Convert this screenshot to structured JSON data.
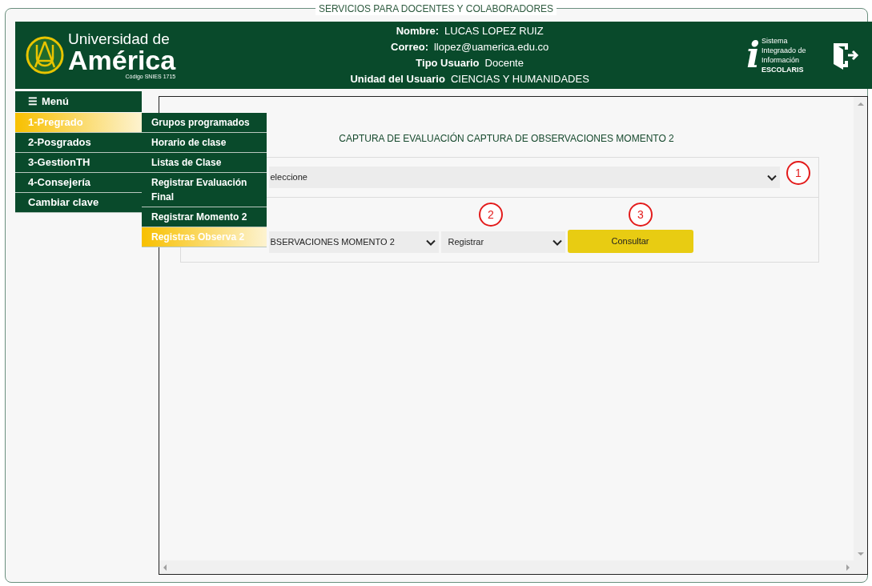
{
  "legend": "SERVICIOS PARA DOCENTES Y COLABORADORES",
  "logo": {
    "line1": "Universidad de",
    "line2": "América",
    "code": "Código SNIES 1715"
  },
  "user_info": [
    {
      "label": "Nombre:",
      "value": "LUCAS LOPEZ RUIZ"
    },
    {
      "label": "Correo:",
      "value": "llopez@uamerica.edu.co"
    },
    {
      "label": "Tipo Usuario",
      "value": "Docente"
    },
    {
      "label": "Unidad del Usuario",
      "value": "CIENCIAS Y HUMANIDADES"
    }
  ],
  "system_logo": {
    "letter": "i",
    "lines": [
      "Sistema",
      "Integraado de",
      "Información"
    ],
    "name": "ESCOLARIS"
  },
  "menu": {
    "icon": "☰",
    "title": "Menú",
    "items": [
      {
        "label": "1-Pregrado",
        "selected": true
      },
      {
        "label": "2-Posgrados",
        "selected": false
      },
      {
        "label": "3-GestionTH",
        "selected": false
      },
      {
        "label": "4-Consejería",
        "selected": false
      },
      {
        "label": "Cambiar clave",
        "selected": false
      }
    ]
  },
  "submenu": [
    {
      "label": "Grupos programados",
      "selected": false
    },
    {
      "label": "Horario de clase",
      "selected": false
    },
    {
      "label": "Listas de Clase",
      "selected": false
    },
    {
      "label": "Registrar Evaluación Final",
      "selected": false
    },
    {
      "label": "Registrar Momento 2",
      "selected": false
    },
    {
      "label": "Registras Observa 2",
      "selected": true
    }
  ],
  "page_title": "CAPTURA DE EVALUACIÓN CAPTURA DE OBSERVACIONES MOMENTO 2",
  "form": {
    "select_1": "eleccione",
    "select_2": "BSERVACIONES MOMENTO 2",
    "select_3": "Registrar",
    "button": "Consultar"
  },
  "markers": [
    "1",
    "2",
    "3"
  ]
}
